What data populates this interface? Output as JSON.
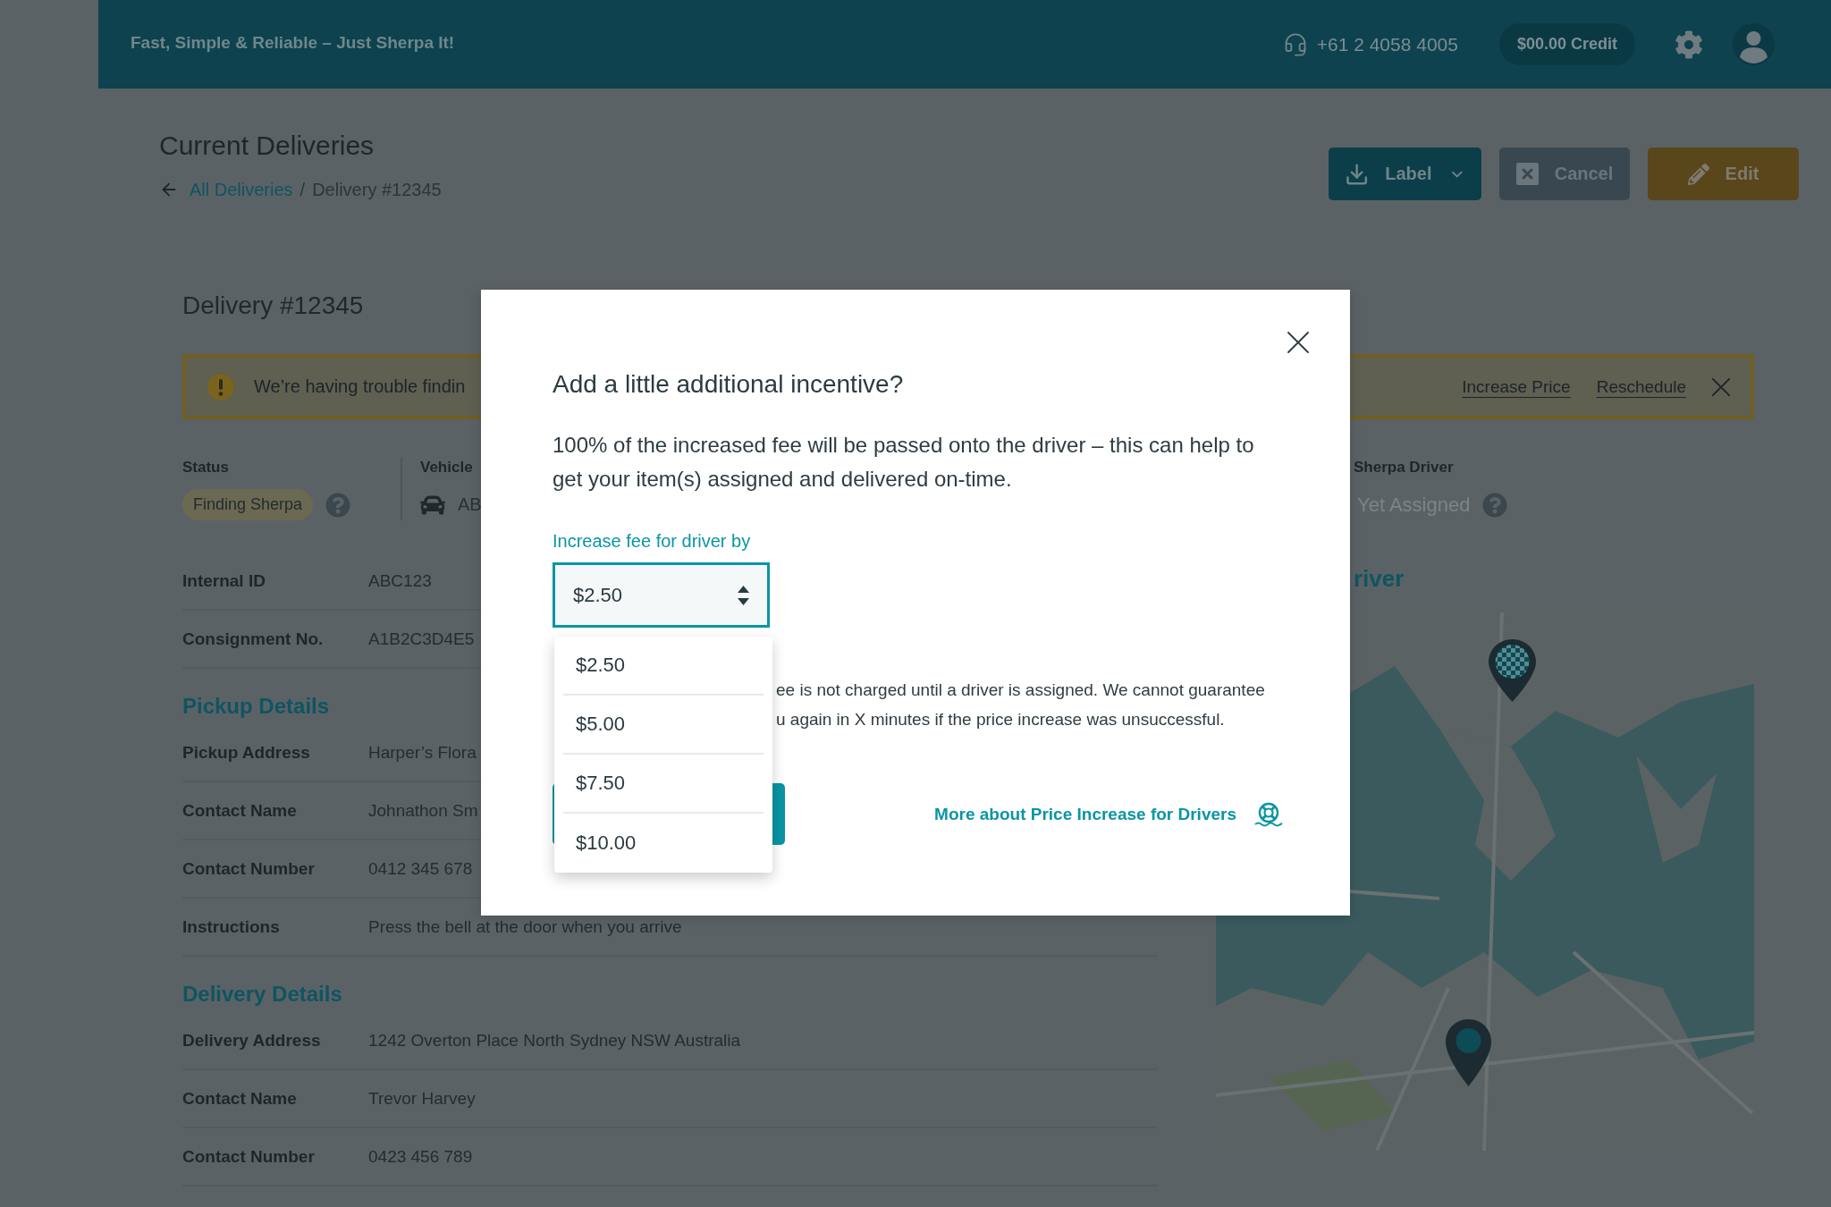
{
  "top_bar": {
    "tagline": "Fast, Simple & Reliable – Just Sherpa It!",
    "phone": "+61 2 4058 4005",
    "credit": "$00.00 Credit"
  },
  "header": {
    "title": "Current Deliveries",
    "breadcrumb": {
      "back_link": "All Deliveries",
      "separator": "/",
      "current": "Delivery #12345"
    },
    "actions": [
      {
        "kind": "download",
        "label": "Label",
        "menu": true
      },
      {
        "kind": "cancel",
        "label": "Cancel",
        "menu": false
      },
      {
        "kind": "edit",
        "label": "Edit",
        "menu": false
      }
    ]
  },
  "delivery": {
    "title": "Delivery #12345",
    "alert": {
      "message": "We’re having trouble findin",
      "links": [
        "Increase Price",
        "Reschedule"
      ]
    },
    "status": {
      "label": "Status",
      "value": "Finding Sherpa"
    },
    "vehicle": {
      "label": "Vehicle",
      "value": "AB"
    },
    "driver": {
      "label": "Sherpa Driver",
      "value": "Yet Assigned"
    },
    "rows": [
      {
        "label": "Internal ID",
        "value": "ABC123"
      },
      {
        "label": "Consignment No.",
        "value": "A1B2C3D4E5"
      }
    ],
    "sections": [
      {
        "title": "Pickup Details",
        "rows": [
          {
            "label": "Pickup Address",
            "value": "Harper’s Flora"
          },
          {
            "label": "Contact Name",
            "value": "Johnathon Sm"
          },
          {
            "label": "Contact Number",
            "value": "0412 345 678"
          },
          {
            "label": "Instructions",
            "value": "Press the bell at the door when you arrive"
          }
        ]
      },
      {
        "title": "Delivery Details",
        "rows": [
          {
            "label": "Delivery Address",
            "value": "1242 Overton Place North Sydney NSW Australia"
          },
          {
            "label": "Contact Name",
            "value": "Trevor Harvey"
          },
          {
            "label": "Contact Number",
            "value": "0423 456 789"
          }
        ]
      }
    ],
    "map_panel": {
      "title": "river"
    }
  },
  "modal": {
    "title": "Add a little additional incentive?",
    "body": "100% of the increased fee will be passed onto the driver – this can help to get your item(s) assigned and delivered on-time.",
    "fee_field": {
      "label": "Increase fee for driver by",
      "value": "$2.50",
      "expanded": true,
      "options": [
        "$2.50",
        "$5.00",
        "$7.50",
        "$10.00"
      ]
    },
    "note_lines": [
      "ee is not charged until a driver is assigned. We cannot guarantee",
      "u again in X minutes if the price increase was unsuccessful."
    ],
    "help_link": "More about Price Increase for Drivers"
  }
}
